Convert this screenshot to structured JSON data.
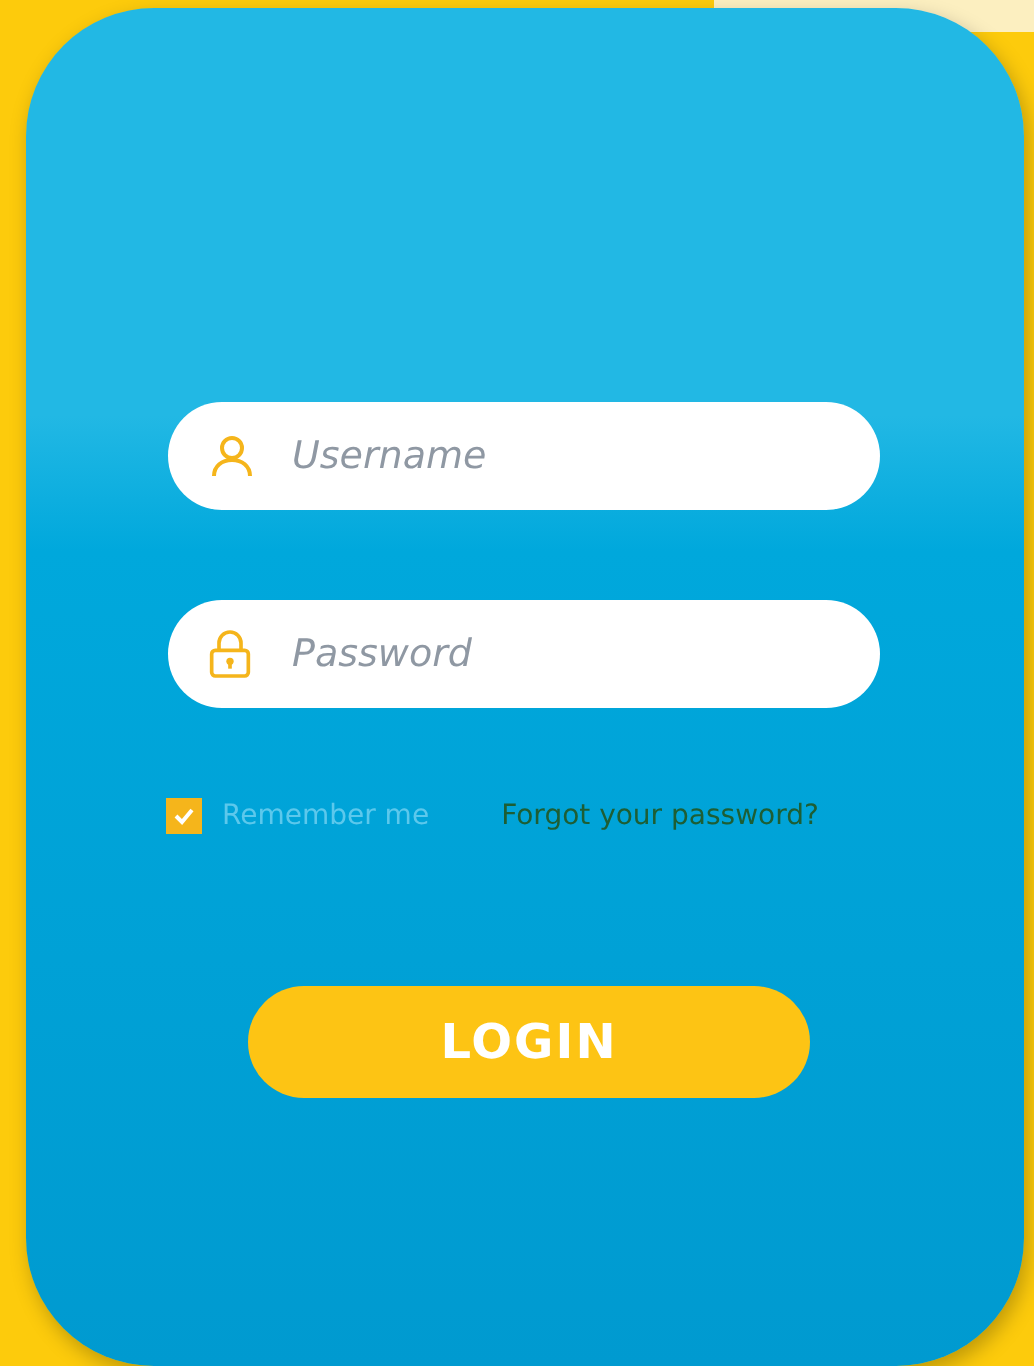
{
  "login_form": {
    "username": {
      "placeholder": "Username"
    },
    "password": {
      "placeholder": "Password"
    },
    "remember_me": {
      "label": "Remember me",
      "checked": true
    },
    "forgot_link": "Forgot your password?",
    "login_button": "LOGIN"
  }
}
